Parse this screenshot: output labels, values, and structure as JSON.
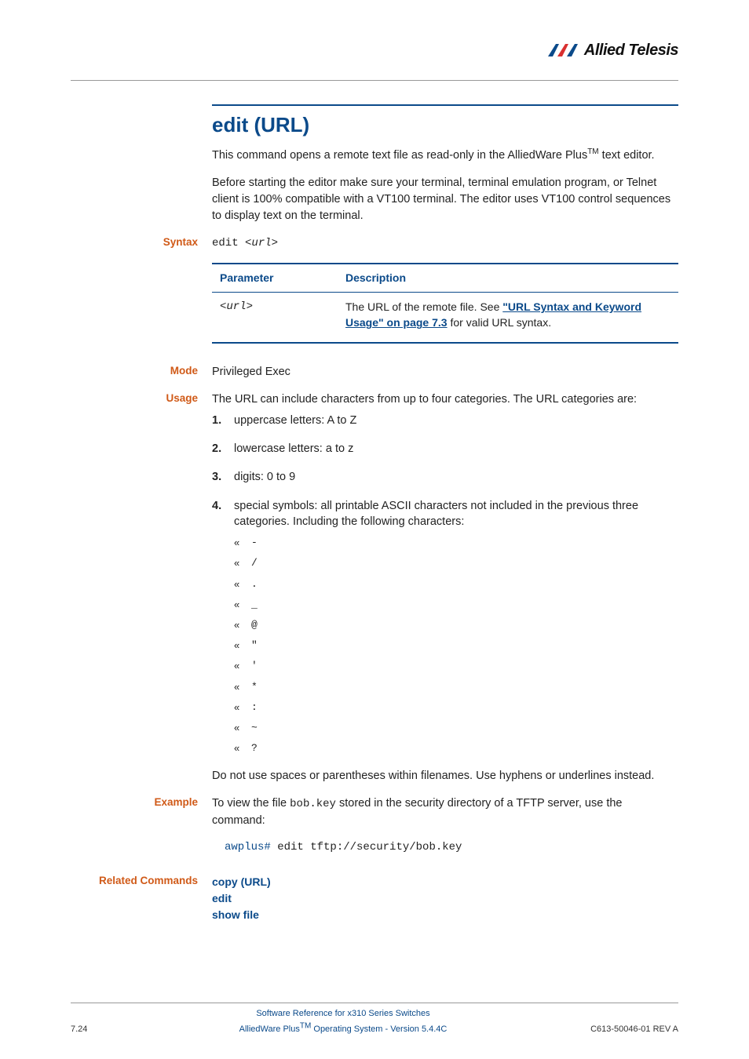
{
  "logo": {
    "brand": "Allied Telesis"
  },
  "title": "edit (URL)",
  "intro1_a": "This command opens a remote text file as read-only in the AlliedWare Plus",
  "intro1_tm": "TM",
  "intro1_b": " text editor.",
  "intro2": "Before starting the editor make sure your terminal, terminal emulation program, or Telnet client is 100% compatible with a VT100 terminal. The editor uses VT100 control sequences to display text on the terminal.",
  "labels": {
    "syntax": "Syntax",
    "mode": "Mode",
    "usage": "Usage",
    "example": "Example",
    "related": "Related Commands"
  },
  "syntax_cmd_a": "edit <",
  "syntax_cmd_b": "url",
  "syntax_cmd_c": ">",
  "param_table": {
    "headers": {
      "param": "Parameter",
      "desc": "Description"
    },
    "rows": [
      {
        "param": "<url>",
        "desc_a": "The URL of the remote file. See ",
        "desc_link": "\"URL Syntax and Keyword Usage\" on page 7.3",
        "desc_b": " for valid URL syntax."
      }
    ]
  },
  "mode_value": "Privileged Exec",
  "usage_intro": "The URL can include characters from up to four categories. The URL categories are:",
  "usage_list": [
    "uppercase letters: A to Z",
    "lowercase letters: a to z",
    "digits: 0 to 9",
    "special symbols: all printable ASCII characters not included in the previous three categories. Including the following characters:"
  ],
  "special_chars": [
    "-",
    "/",
    ".",
    "_",
    "@",
    "\"",
    "'",
    "*",
    ":",
    "~",
    "?"
  ],
  "usage_note": "Do not use spaces or parentheses within filenames. Use hyphens or underlines instead.",
  "example_text_a": "To view the file ",
  "example_text_file": "bob.key",
  "example_text_b": " stored in the security directory of a TFTP server, use the command:",
  "example_prompt": "awplus#",
  "example_cmd": " edit tftp://security/bob.key",
  "related_links": [
    "copy (URL)",
    "edit",
    "show file"
  ],
  "footer": {
    "page": "7.24",
    "line1": "Software Reference for x310 Series Switches",
    "line2_a": "AlliedWare Plus",
    "line2_tm": "TM",
    "line2_b": " Operating System  - Version 5.4.4C",
    "rev": "C613-50046-01 REV A"
  }
}
